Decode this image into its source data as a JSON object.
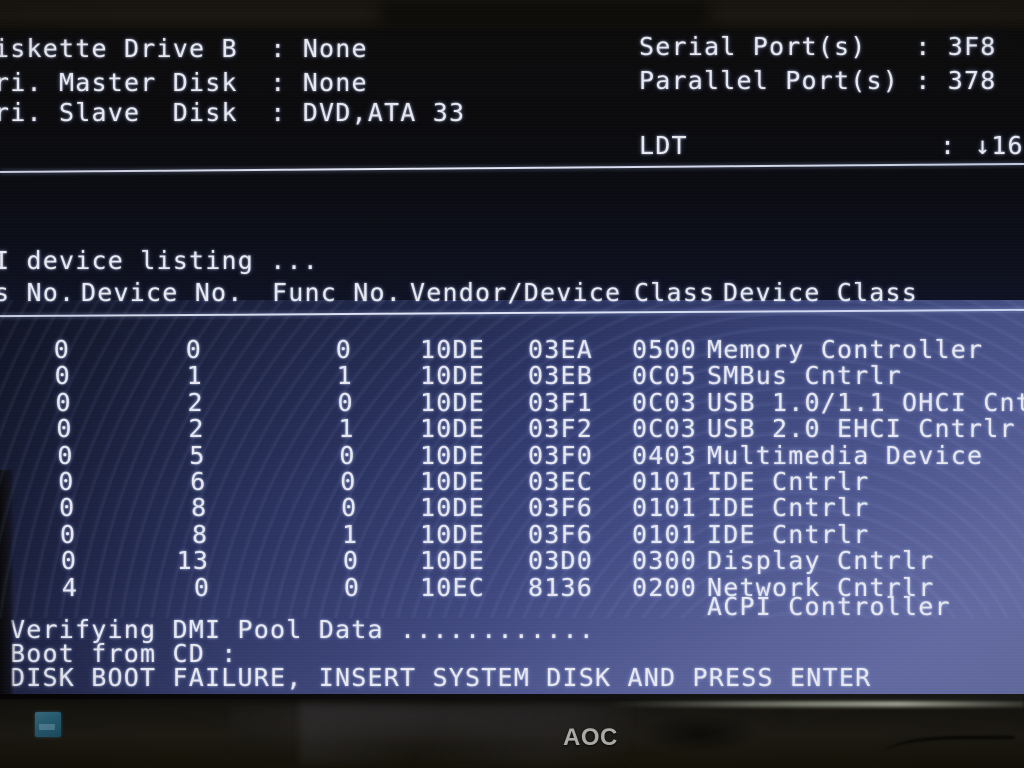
{
  "screen": {
    "system_info_left": [
      "iskette Drive B  : None",
      "ri. Master Disk  : None",
      "ri. Slave  Disk  : DVD,ATA 33"
    ],
    "system_info_right": [
      "Serial Port(s)   : 3F8",
      "Parallel Port(s) : 378"
    ],
    "ldt_label": "LDT",
    "ldt_separator": ":",
    "ldt_value": "↓16",
    "pci_listing_title": "I device listing ...",
    "pci_header": "s No. Device No. Func No. Vendor/Device Class Device Class",
    "pci_header_cols": {
      "bus": "s No.",
      "device": "Device No.",
      "func": "Func No.",
      "vendor_device": "Vendor/Device",
      "class": "Class",
      "device_class": "Device Class"
    },
    "pci_devices": [
      {
        "bus": "0",
        "device": "0",
        "func": "0",
        "vendor": "10DE",
        "device_id": "03EA",
        "class": "0500",
        "name": "Memory Controller"
      },
      {
        "bus": "0",
        "device": "1",
        "func": "1",
        "vendor": "10DE",
        "device_id": "03EB",
        "class": "0C05",
        "name": "SMBus Cntrlr"
      },
      {
        "bus": "0",
        "device": "2",
        "func": "0",
        "vendor": "10DE",
        "device_id": "03F1",
        "class": "0C03",
        "name": "USB 1.0/1.1 OHCI Cnt"
      },
      {
        "bus": "0",
        "device": "2",
        "func": "1",
        "vendor": "10DE",
        "device_id": "03F2",
        "class": "0C03",
        "name": "USB 2.0 EHCI Cntrlr"
      },
      {
        "bus": "0",
        "device": "5",
        "func": "0",
        "vendor": "10DE",
        "device_id": "03F0",
        "class": "0403",
        "name": "Multimedia Device"
      },
      {
        "bus": "0",
        "device": "6",
        "func": "0",
        "vendor": "10DE",
        "device_id": "03EC",
        "class": "0101",
        "name": "IDE Cntrlr"
      },
      {
        "bus": "0",
        "device": "8",
        "func": "0",
        "vendor": "10DE",
        "device_id": "03F6",
        "class": "0101",
        "name": "IDE Cntrlr"
      },
      {
        "bus": "0",
        "device": "8",
        "func": "1",
        "vendor": "10DE",
        "device_id": "03F6",
        "class": "0101",
        "name": "IDE Cntrlr"
      },
      {
        "bus": "0",
        "device": "13",
        "func": "0",
        "vendor": "10DE",
        "device_id": "03D0",
        "class": "0300",
        "name": "Display Cntrlr"
      },
      {
        "bus": "4",
        "device": "0",
        "func": "0",
        "vendor": "10EC",
        "device_id": "8136",
        "class": "0200",
        "name": "Network Cntrlr"
      }
    ],
    "pci_extra_device_name": "ACPI Controller",
    "boot_messages": [
      "Verifying DMI Pool Data ............",
      "Boot from CD :",
      "DISK BOOT FAILURE, INSERT SYSTEM DISK AND PRESS ENTER"
    ]
  },
  "monitor": {
    "brand": "AOC"
  },
  "colors": {
    "text": "#e9eaf2",
    "screen_dark": "#0b0b0e",
    "screen_blue": "#434c85",
    "bezel": "#16140f",
    "sticker": "#2b6d86"
  }
}
